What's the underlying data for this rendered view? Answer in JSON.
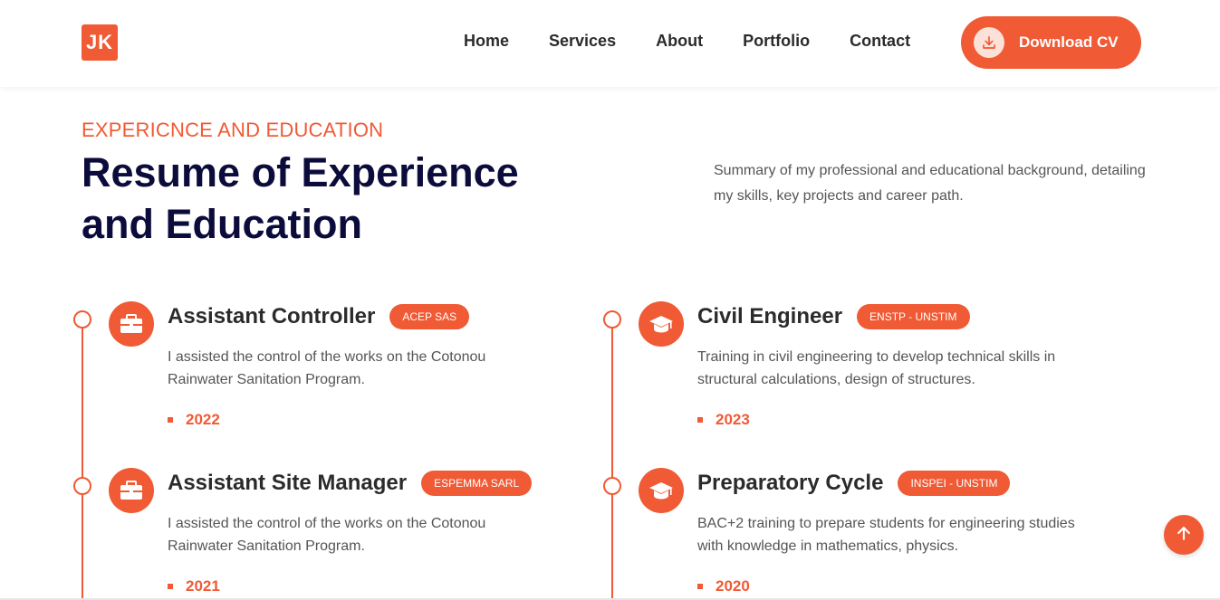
{
  "header": {
    "logo_text": "JK",
    "nav": [
      "Home",
      "Services",
      "About",
      "Portfolio",
      "Contact"
    ],
    "cta_label": "Download CV"
  },
  "section": {
    "eyebrow": "EXPERICNCE AND EDUCATION",
    "title_line1": "Resume of Experience",
    "title_line2": "and Education",
    "summary": "Summary of my professional and educational background, detailing my skills, key projects and career path."
  },
  "experience": [
    {
      "role": "Assistant Controller",
      "badge": "ACEP SAS",
      "description": "I assisted the control of the works on the Cotonou Rainwater Sanitation Program.",
      "year": "2022",
      "icon": "briefcase-icon"
    },
    {
      "role": "Assistant Site Manager",
      "badge": "ESPEMMA SARL",
      "description": "I assisted the control of the works on the Cotonou Rainwater Sanitation Program.",
      "year": "2021",
      "icon": "briefcase-icon"
    }
  ],
  "education": [
    {
      "role": "Civil Engineer",
      "badge": "ENSTP - UNSTIM",
      "description": "Training in civil engineering to develop technical skills in structural calculations, design of structures.",
      "year": "2023",
      "icon": "graduation-cap-icon"
    },
    {
      "role": "Preparatory Cycle",
      "badge": "INSPEI - UNSTIM",
      "description": "BAC+2 training to prepare students for engineering studies with knowledge in mathematics, physics.",
      "year": "2020",
      "icon": "graduation-cap-icon"
    }
  ],
  "colors": {
    "accent": "#f05a34",
    "heading": "#0c0c3c"
  }
}
